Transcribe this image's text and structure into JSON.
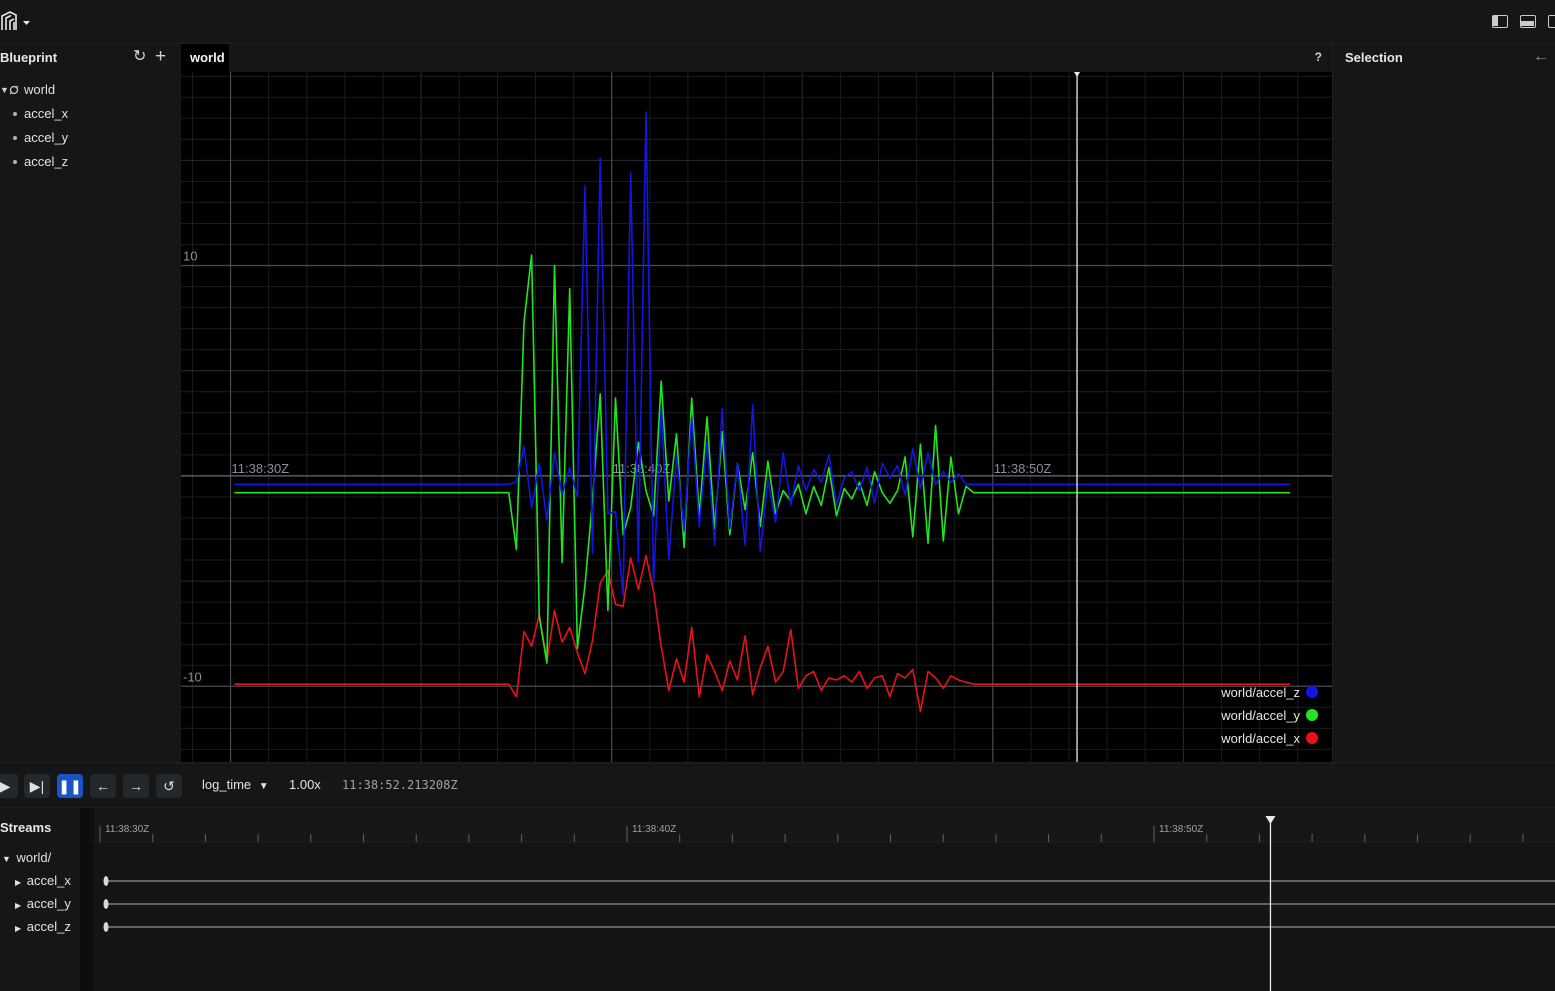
{
  "app": {
    "logo_icon": "rerun-logo-icon"
  },
  "blueprint": {
    "title": "Blueprint",
    "tree": [
      {
        "label": "world",
        "kind": "space-view"
      },
      {
        "label": "accel_x",
        "kind": "entity"
      },
      {
        "label": "accel_y",
        "kind": "entity"
      },
      {
        "label": "accel_z",
        "kind": "entity"
      }
    ]
  },
  "view": {
    "tab_label": "world",
    "help": "?"
  },
  "selection": {
    "title": "Selection"
  },
  "playback": {
    "timeline": "log_time",
    "speed": "1.00x",
    "current_time": "11:38:52.213208Z"
  },
  "streams": {
    "title": "Streams",
    "root": "world/",
    "items": [
      "accel_x",
      "accel_y",
      "accel_z"
    ],
    "time_labels": [
      "11:38:30Z",
      "11:38:40Z",
      "11:38:50Z"
    ]
  },
  "chart_data": {
    "type": "line",
    "x_unit": "seconds after 11:38:00Z",
    "x_tick_labels": [
      {
        "x": 30,
        "label": "11:38:30Z"
      },
      {
        "x": 40,
        "label": "11:38:40Z"
      },
      {
        "x": 50,
        "label": "11:38:50Z"
      }
    ],
    "y_tick_labels": [
      {
        "y": 10,
        "label": "10"
      },
      {
        "y": -10,
        "label": "-10"
      }
    ],
    "xlim": [
      28.7,
      58.9
    ],
    "ylim": [
      -13.6,
      19.2
    ],
    "time_cursor_x": 52.21,
    "legend_position": "bottom-right",
    "grid": true,
    "series": [
      {
        "name": "world/accel_x",
        "color": "#e8121b",
        "x": [
          30.1,
          37.3,
          37.5,
          37.7,
          37.9,
          38.1,
          38.3,
          38.5,
          38.7,
          38.9,
          39.1,
          39.3,
          39.5,
          39.7,
          39.9,
          40.1,
          40.3,
          40.5,
          40.7,
          40.9,
          41.1,
          41.3,
          41.5,
          41.7,
          41.9,
          42.1,
          42.3,
          42.5,
          42.7,
          42.9,
          43.1,
          43.3,
          43.5,
          43.7,
          43.9,
          44.1,
          44.3,
          44.5,
          44.7,
          44.9,
          45.1,
          45.3,
          45.5,
          45.7,
          45.9,
          46.1,
          46.3,
          46.5,
          46.7,
          46.9,
          47.1,
          47.3,
          47.5,
          47.7,
          47.9,
          48.1,
          48.3,
          48.5,
          48.7,
          48.9,
          49.1,
          49.3,
          49.5,
          57.8
        ],
        "y": [
          -9.9,
          -9.9,
          -10.5,
          -7.4,
          -8.1,
          -6.6,
          -8.8,
          -6.4,
          -7.9,
          -7.2,
          -8.4,
          -9.4,
          -7.8,
          -5.1,
          -4.5,
          -6.1,
          -6.2,
          -3.9,
          -5.4,
          -3.8,
          -5.5,
          -8.1,
          -10.2,
          -8.7,
          -9.8,
          -7.2,
          -10.5,
          -8.5,
          -9.3,
          -10.2,
          -8.8,
          -9.7,
          -7.6,
          -10.4,
          -9.1,
          -8.1,
          -9.8,
          -9.3,
          -7.3,
          -10.1,
          -9.5,
          -9.3,
          -10.2,
          -9.6,
          -9.7,
          -9.5,
          -9.8,
          -9.3,
          -10.1,
          -9.6,
          -9.5,
          -10.5,
          -9.4,
          -9.6,
          -9.2,
          -11.2,
          -9.3,
          -9.6,
          -10.1,
          -9.5,
          -9.7,
          -9.8,
          -9.9,
          -9.9
        ]
      },
      {
        "name": "world/accel_y",
        "color": "#21e61f",
        "x": [
          30.1,
          37.3,
          37.5,
          37.7,
          37.9,
          38.1,
          38.3,
          38.5,
          38.7,
          38.9,
          39.1,
          39.3,
          39.5,
          39.7,
          39.9,
          40.1,
          40.3,
          40.5,
          40.7,
          40.9,
          41.1,
          41.3,
          41.5,
          41.7,
          41.9,
          42.1,
          42.3,
          42.5,
          42.7,
          42.9,
          43.1,
          43.3,
          43.5,
          43.7,
          43.9,
          44.1,
          44.3,
          44.5,
          44.7,
          44.9,
          45.1,
          45.3,
          45.5,
          45.7,
          45.9,
          46.1,
          46.3,
          46.5,
          46.7,
          46.9,
          47.1,
          47.3,
          47.5,
          47.7,
          47.9,
          48.1,
          48.3,
          48.5,
          48.7,
          48.9,
          49.1,
          49.3,
          49.5,
          57.8
        ],
        "y": [
          -0.8,
          -0.8,
          -3.5,
          7.3,
          10.5,
          -6.7,
          -8.9,
          10.0,
          -4.1,
          8.9,
          -8.2,
          -5.2,
          -1.1,
          3.9,
          -6.4,
          3.7,
          -2.8,
          -1.5,
          1.6,
          -0.7,
          -1.9,
          4.5,
          -1.2,
          2.0,
          -3.4,
          3.7,
          -1.9,
          2.8,
          -2.5,
          2.1,
          -2.8,
          0.6,
          -1.6,
          1.1,
          -2.4,
          0.7,
          -1.8,
          -0.7,
          -1.2,
          -0.4,
          -1.8,
          -0.5,
          -1.4,
          0.4,
          -1.9,
          -0.6,
          -1.1,
          -0.3,
          -1.4,
          0.2,
          -0.8,
          -1.3,
          -0.7,
          0.9,
          -2.9,
          1.5,
          -3.2,
          2.4,
          -3.1,
          0.9,
          -1.8,
          -0.5,
          -0.8,
          -0.8
        ]
      },
      {
        "name": "world/accel_z",
        "color": "#1414e4",
        "x": [
          30.1,
          37.3,
          37.5,
          37.7,
          37.9,
          38.1,
          38.3,
          38.5,
          38.7,
          38.9,
          39.1,
          39.3,
          39.5,
          39.7,
          39.9,
          40.1,
          40.3,
          40.5,
          40.7,
          40.9,
          41.1,
          41.3,
          41.5,
          41.7,
          41.9,
          42.1,
          42.3,
          42.5,
          42.7,
          42.9,
          43.1,
          43.3,
          43.5,
          43.7,
          43.9,
          44.1,
          44.3,
          44.5,
          44.7,
          44.9,
          45.1,
          45.3,
          45.5,
          45.7,
          45.9,
          46.1,
          46.3,
          46.5,
          46.7,
          46.9,
          47.1,
          47.3,
          47.5,
          47.7,
          47.9,
          48.1,
          48.3,
          48.5,
          48.7,
          48.9,
          49.1,
          49.3,
          49.5,
          57.8
        ],
        "y": [
          -0.4,
          -0.4,
          -0.3,
          1.4,
          -1.5,
          0.6,
          -2.1,
          1.1,
          -0.9,
          0.4,
          -1.0,
          13.8,
          -3.7,
          15.1,
          -1.8,
          -1.7,
          -5.7,
          14.4,
          -4.1,
          17.3,
          -5.1,
          3.2,
          -4.0,
          1.0,
          -2.6,
          2.8,
          -2.4,
          1.6,
          -3.3,
          3.2,
          -2.5,
          0.6,
          -3.3,
          3.4,
          -3.6,
          -0.2,
          -2.2,
          1.1,
          -1.4,
          0.5,
          -0.7,
          0.3,
          -0.3,
          1.0,
          -1.4,
          -0.1,
          0.2,
          -0.7,
          0.4,
          -1.3,
          0.6,
          -0.1,
          0.5,
          -0.9,
          1.3,
          -0.6,
          1.1,
          -0.4,
          0.2,
          -0.3,
          0.1,
          -0.4,
          -0.4,
          -0.4
        ]
      }
    ]
  }
}
